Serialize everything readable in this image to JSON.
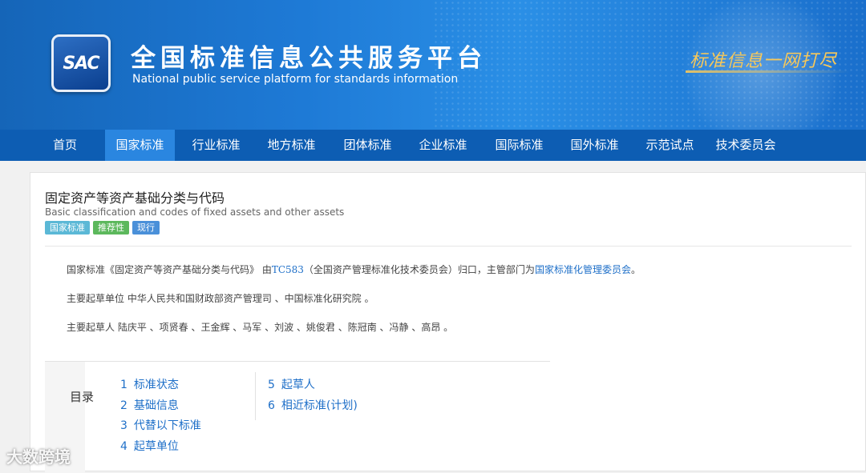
{
  "header": {
    "logo_text": "SAC",
    "title_cn": "全国标准信息公共服务平台",
    "title_en": "National public service platform  for standards information",
    "slogan": "标准信息一网打尽"
  },
  "nav": {
    "items": [
      {
        "label": "首页"
      },
      {
        "label": "国家标准"
      },
      {
        "label": "行业标准"
      },
      {
        "label": "地方标准"
      },
      {
        "label": "团体标准"
      },
      {
        "label": "企业标准"
      },
      {
        "label": "国际标准"
      },
      {
        "label": "国外标准"
      },
      {
        "label": "示范试点"
      },
      {
        "label": "技术委员会"
      }
    ],
    "active": "国家标准"
  },
  "standard": {
    "title": "固定资产等资产基础分类与代码",
    "title_en": "Basic classification and codes of fixed assets and other assets",
    "badges": [
      {
        "label": "国家标准",
        "color": "#5bb8d6"
      },
      {
        "label": "推荐性",
        "color": "#5cb85c"
      },
      {
        "label": "现行",
        "color": "#4a90d9"
      }
    ],
    "intro": {
      "prefix": "国家标准《固定资产等资产基础分类与代码》 由",
      "tc_link": "TC583",
      "middle": "（全国资产管理标准化技术委员会）归口，主管部门为",
      "dept_link": "国家标准化管理委员会",
      "suffix": "。"
    },
    "drafting_units": "主要起草单位 中华人民共和国财政部资产管理司 、中国标准化研究院 。",
    "drafters": "主要起草人 陆庆平 、项贤春 、王金辉 、马军 、刘波 、姚俊君 、陈冠南 、冯静 、高昂 。"
  },
  "toc": {
    "label": "目录",
    "items": [
      {
        "num": "1",
        "label": "标准状态"
      },
      {
        "num": "2",
        "label": "基础信息"
      },
      {
        "num": "3",
        "label": "代替以下标准"
      },
      {
        "num": "4",
        "label": "起草单位"
      },
      {
        "num": "5",
        "label": "起草人"
      },
      {
        "num": "6",
        "label": "相近标准(计划)"
      }
    ]
  },
  "watermark": "大数跨境",
  "colors": {
    "nav_bg": "#0d5db3",
    "nav_active": "#2a86e0",
    "link": "#1e6fc8"
  }
}
